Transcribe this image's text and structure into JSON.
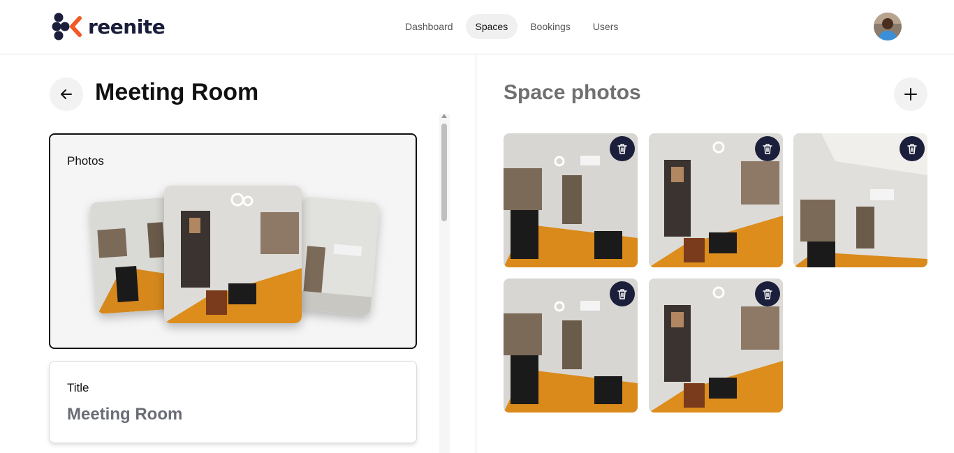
{
  "brand": {
    "name": "reenite"
  },
  "nav": {
    "items": [
      {
        "label": "Dashboard"
      },
      {
        "label": "Spaces"
      },
      {
        "label": "Bookings"
      },
      {
        "label": "Users"
      }
    ],
    "active": "Spaces"
  },
  "page": {
    "title": "Meeting Room"
  },
  "photos_card": {
    "label": "Photos"
  },
  "title_field": {
    "label": "Title",
    "value": "Meeting Room"
  },
  "space_photos": {
    "heading": "Space photos",
    "count": 5
  },
  "colors": {
    "navy": "#1c1f3b",
    "orange": "#f15a24",
    "wood": "#d98a1a"
  },
  "icons": [
    "back-arrow-icon",
    "plus-icon",
    "trash-icon"
  ]
}
